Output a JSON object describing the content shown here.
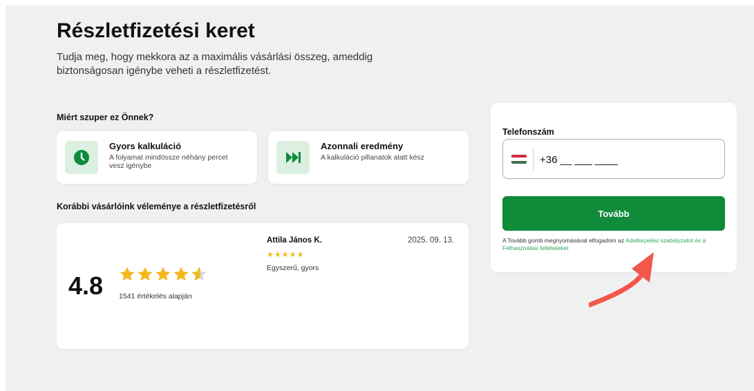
{
  "page": {
    "title": "Részletfizetési keret",
    "subtitle": "Tudja meg, hogy mekkora az a maximális vásárlási összeg, ameddig biztonságosan igénybe veheti a részletfizetést."
  },
  "why_section": {
    "heading": "Miért szuper ez Önnek?",
    "features": [
      {
        "icon": "clock-icon",
        "title": "Gyors kalkuláció",
        "description": "A folyamat mindössze néhány percet vesz igénybe"
      },
      {
        "icon": "fast-forward-icon",
        "title": "Azonnali eredmény",
        "description": "A kalkuláció pillanatok alatt kész"
      }
    ]
  },
  "reviews_section": {
    "heading": "Korábbi vásárlóink véleménye a részletfizetésről",
    "rating": {
      "value": "4.8",
      "stars": 4.8,
      "max_stars": 5,
      "count_text": "1541 értékelés alapján"
    },
    "review": {
      "author": "Attila János K.",
      "date": "2025. 09. 13.",
      "stars_text": "★★★★★",
      "text": "Egyszerű, gyors"
    }
  },
  "form": {
    "phone_label": "Telefonszám",
    "phone_value": "+36 __ ___ ____",
    "country_flag": "hungary-flag-icon",
    "submit_label": "Tovább",
    "consent_prefix": "A Tovább gomb megnyomásával elfogadom az ",
    "consent_link": "Adatkezelési szabályzatot és a Felhasználási feltételeket"
  },
  "colors": {
    "accent_green": "#0f8b3a",
    "icon_bg": "#dcf0e2",
    "star_yellow": "#f3b81b",
    "arrow_red": "#f2574b",
    "flag": [
      "#cd2a3e",
      "#ffffff",
      "#436f4d"
    ]
  }
}
